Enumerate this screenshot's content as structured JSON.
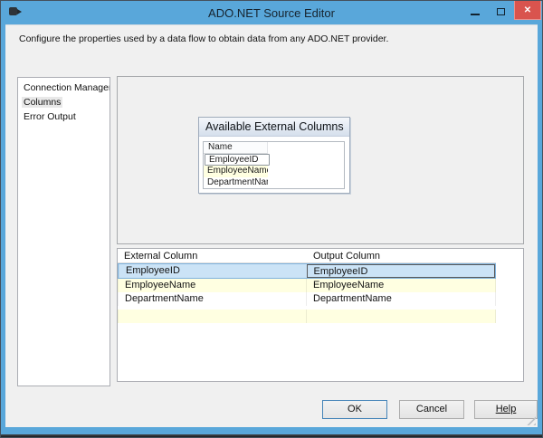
{
  "window": {
    "title": "ADO.NET Source Editor"
  },
  "header": {
    "description": "Configure the properties used by a data flow to obtain data from any ADO.NET provider."
  },
  "sidebar": {
    "items": [
      {
        "label": "Connection Manager",
        "selected": false
      },
      {
        "label": "Columns",
        "selected": true
      },
      {
        "label": "Error Output",
        "selected": false
      }
    ]
  },
  "available_external_columns": {
    "title": "Available External Columns",
    "name_header": "Name",
    "rows": [
      {
        "name": "EmployeeID",
        "state": "focused"
      },
      {
        "name": "EmployeeName",
        "state": "yellow"
      },
      {
        "name": "DepartmentName",
        "state": "normal"
      }
    ]
  },
  "mapping_table": {
    "headers": {
      "external": "External Column",
      "output": "Output Column"
    },
    "rows": [
      {
        "external": "EmployeeID",
        "output": "EmployeeID",
        "selected": true
      },
      {
        "external": "EmployeeName",
        "output": "EmployeeName",
        "selected": false
      },
      {
        "external": "DepartmentName",
        "output": "DepartmentName",
        "selected": false
      },
      {
        "external": "",
        "output": "",
        "selected": false
      }
    ]
  },
  "footer": {
    "ok": "OK",
    "cancel": "Cancel",
    "help": "Help"
  },
  "colors": {
    "titlebar_blue": "#59a7da",
    "close_red": "#d9544e",
    "dialog_bg": "#f0f0f0",
    "selection_blue": "#cbe3f6",
    "alt_row_yellow": "#ffffe1",
    "default_button_border": "#4584b8"
  }
}
